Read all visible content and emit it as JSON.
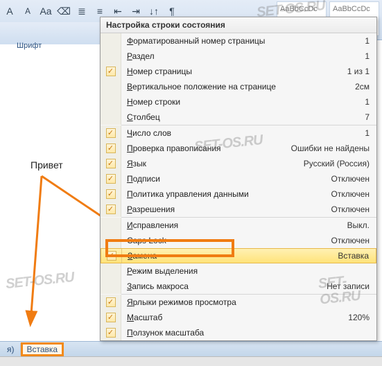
{
  "ribbon": {
    "group_label": "Шрифт",
    "style1": "AaBbCcDc",
    "style2": "AaBbCcDc"
  },
  "document": {
    "text": "Привет"
  },
  "status_bar": {
    "segment1": "я)",
    "segment2": "Вставка"
  },
  "menu": {
    "title": "Настройка строки состояния",
    "items": [
      {
        "checked": false,
        "label": "Форматированный номер страницы",
        "value": "1",
        "accel": "Ф"
      },
      {
        "checked": false,
        "label": "Раздел",
        "value": "1",
        "accel": "Р"
      },
      {
        "checked": true,
        "label": "Номер страницы",
        "value": "1 из 1",
        "accel": "Н"
      },
      {
        "checked": false,
        "label": "Вертикальное положение на странице",
        "value": "2см",
        "accel": "В"
      },
      {
        "checked": false,
        "label": "Номер строки",
        "value": "1",
        "accel": "Н"
      },
      {
        "checked": false,
        "label": "Столбец",
        "value": "7",
        "accel": "С"
      },
      {
        "sep": true
      },
      {
        "checked": true,
        "label": "Число слов",
        "value": "1",
        "accel": "Ч"
      },
      {
        "checked": true,
        "label": "Проверка правописания",
        "value": "Ошибки не найдены",
        "accel": "П"
      },
      {
        "checked": true,
        "label": "Язык",
        "value": "Русский (Россия)",
        "accel": "Я"
      },
      {
        "checked": true,
        "label": "Подписи",
        "value": "Отключен",
        "accel": "П"
      },
      {
        "checked": true,
        "label": "Политика управления данными",
        "value": "Отключен",
        "accel": "П"
      },
      {
        "checked": true,
        "label": "Разрешения",
        "value": "Отключен",
        "accel": "Р"
      },
      {
        "sep": true
      },
      {
        "checked": false,
        "label": "Исправления",
        "value": "Выкл.",
        "accel": "И"
      },
      {
        "checked": false,
        "label": "Caps Lock",
        "value": "Отключен",
        "accel": ""
      },
      {
        "checked": true,
        "label": "Замена",
        "value": "Вставка",
        "accel": "З",
        "selected": true
      },
      {
        "checked": false,
        "label": "Режим выделения",
        "value": "",
        "accel": "Р"
      },
      {
        "checked": false,
        "label": "Запись макроса",
        "value": "Нет записи",
        "accel": "З"
      },
      {
        "sep": true
      },
      {
        "checked": true,
        "label": "Ярлыки режимов просмотра",
        "value": "",
        "accel": "Я"
      },
      {
        "checked": true,
        "label": "Масштаб",
        "value": "120%",
        "accel": "М"
      },
      {
        "checked": true,
        "label": "Ползунок масштаба",
        "value": "",
        "accel": "П"
      }
    ]
  },
  "watermark": "SET-OS.RU"
}
